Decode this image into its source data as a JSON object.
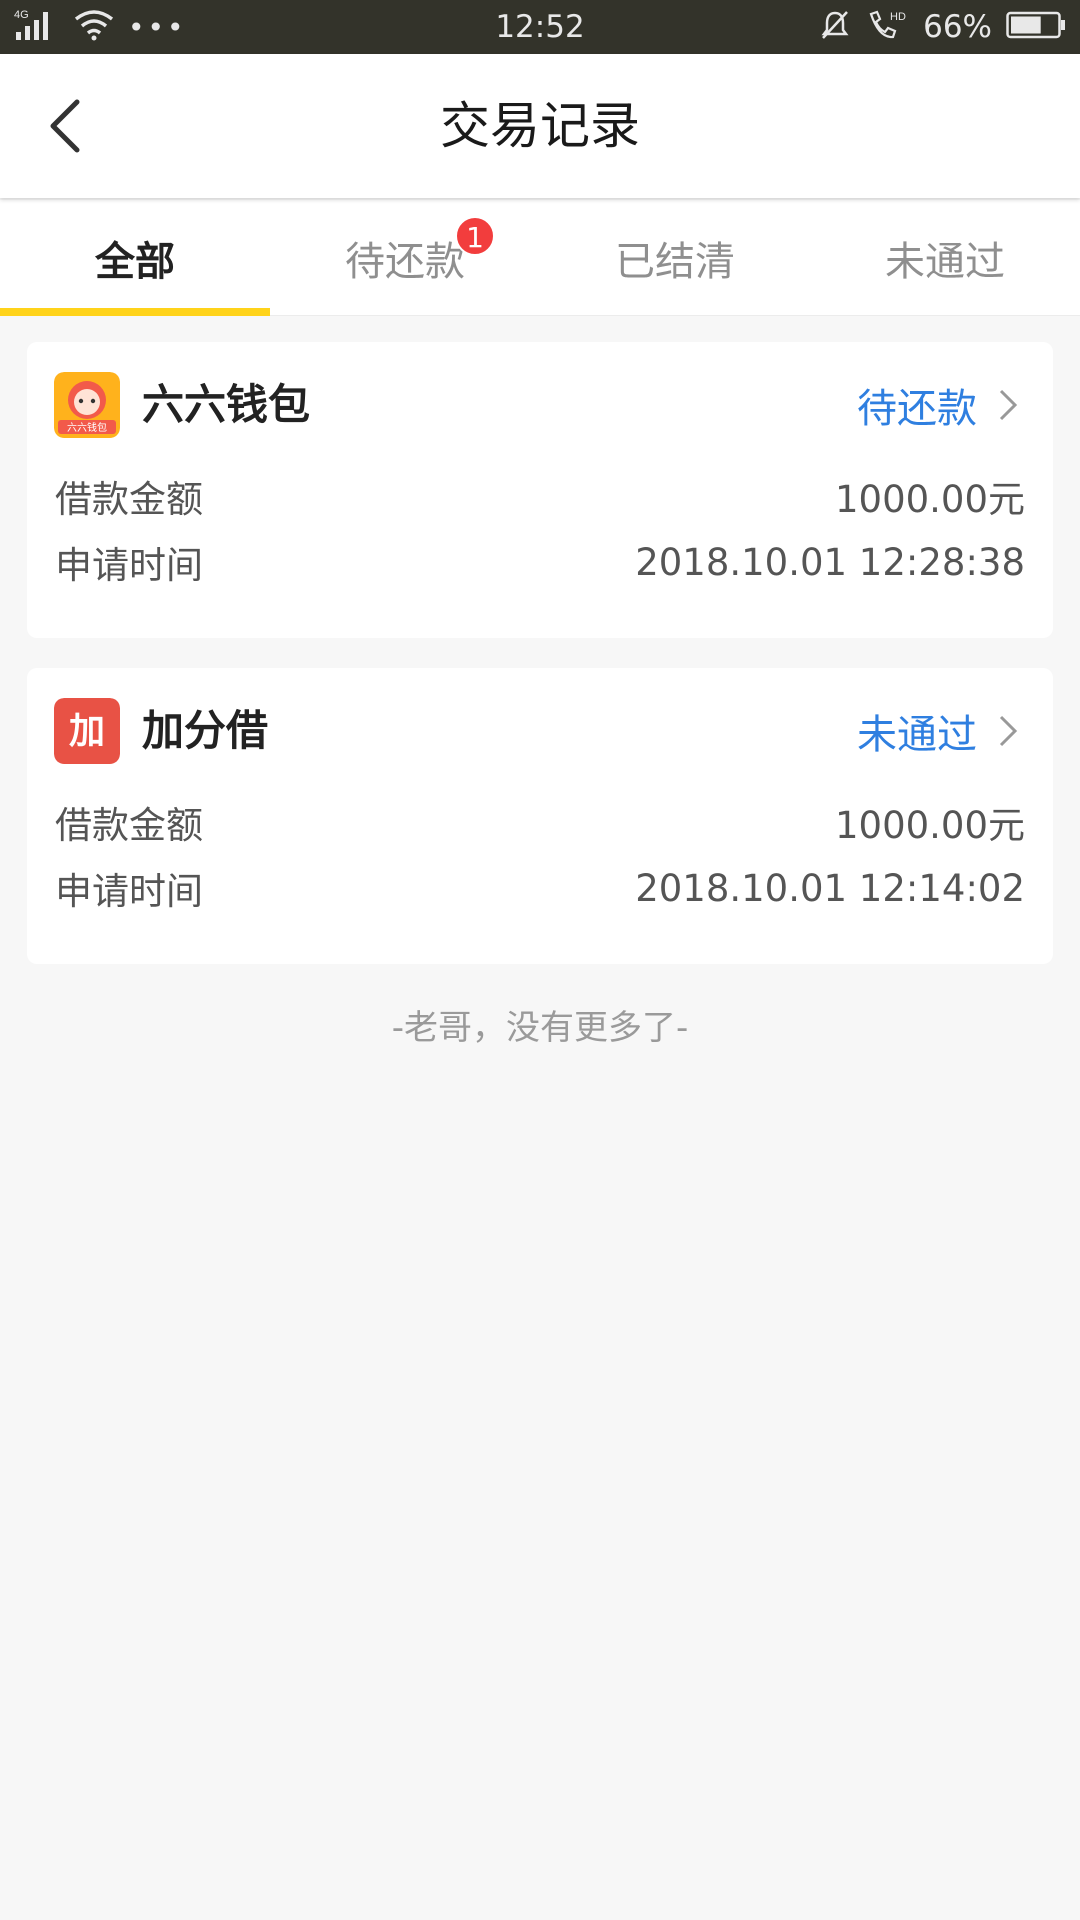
{
  "status_bar": {
    "network": "4G",
    "time": "12:52",
    "hd_label": "HD",
    "battery": "66%",
    "battery_level": 0.66
  },
  "header": {
    "back_icon": "chevron-left-icon",
    "title": "交易记录"
  },
  "tabs": [
    {
      "label": "全部",
      "active": true
    },
    {
      "label": "待还款",
      "active": false,
      "badge": "1"
    },
    {
      "label": "已结清",
      "active": false
    },
    {
      "label": "未通过",
      "active": false
    }
  ],
  "records": [
    {
      "app_name": "六六钱包",
      "icon_text": "六六钱包",
      "status": "待还款",
      "amount_label": "借款金额",
      "amount": "1000.00元",
      "time_label": "申请时间",
      "time": "2018.10.01 12:28:38"
    },
    {
      "app_name": "加分借",
      "icon_text": "加",
      "status": "未通过",
      "amount_label": "借款金额",
      "amount": "1000.00元",
      "time_label": "申请时间",
      "time": "2018.10.01 12:14:02"
    }
  ],
  "footer_note": "-老哥，没有更多了-",
  "colors": {
    "accent_yellow": "#ffd31a",
    "link_blue": "#2f7fe0",
    "badge_red": "#f23d3d",
    "status_bar_bg": "#33332a",
    "page_bg": "#f7f7f7"
  }
}
